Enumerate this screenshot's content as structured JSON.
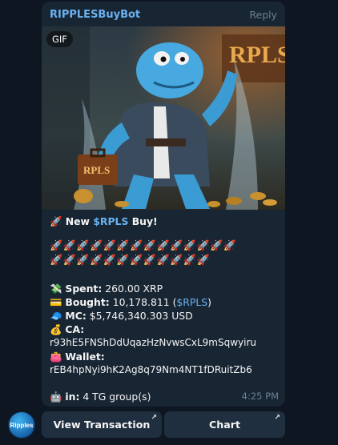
{
  "message": {
    "sender": "RIPPLESBuyBot",
    "reply_label": "Reply",
    "gif_badge": "GIF",
    "media_sign_text": "RPLS",
    "briefcase_text": "RPLS",
    "title_icon": "🚀",
    "title_prefix": "New ",
    "title_ticker": "$RPLS",
    "title_suffix": " Buy!",
    "rockets_row1": "🚀🚀🚀🚀🚀🚀🚀🚀🚀🚀🚀🚀🚀🚀",
    "rockets_row2": "🚀🚀🚀🚀🚀🚀🚀🚀🚀🚀🚀🚀",
    "spent": {
      "icon": "💸",
      "label": "Spent:",
      "value": " 260.00 XRP"
    },
    "bought": {
      "icon": "💳",
      "label": "Bought:",
      "value": " 10,178.811 (",
      "ticker": "$RPLS",
      "close": ")"
    },
    "mc": {
      "icon": "🧢",
      "label": "MC:",
      "value": " $5,746,340.303 USD"
    },
    "ca": {
      "icon": "💰",
      "label": "CA:",
      "value": "r93hE5FNShDdUqazHzNvwsCxL9mSqwyiru"
    },
    "wallet": {
      "icon": "👛",
      "label": "Wallet:",
      "value": "rEB4hpNyi9hK2Ag8q79Nm4NT1fDRuitZb6"
    },
    "groups": {
      "icon": "🤖",
      "label": "in:",
      "value": " 4 TG group(s)"
    },
    "time": "4:25 PM"
  },
  "avatar": {
    "label": "Ripples"
  },
  "buttons": [
    {
      "label": "View Transaction"
    },
    {
      "label": "Chart"
    }
  ]
}
